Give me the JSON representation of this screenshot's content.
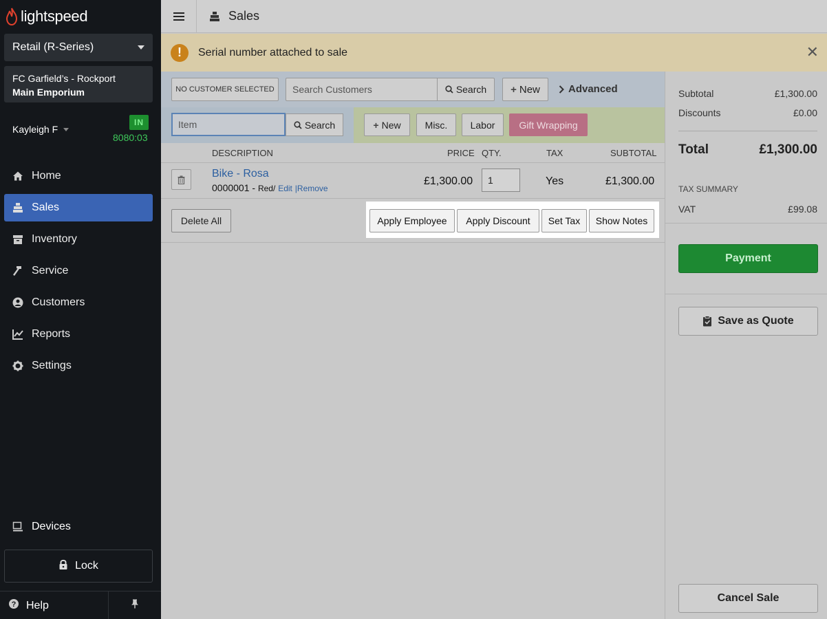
{
  "app": {
    "logo_text": "lightspeed"
  },
  "sidebar": {
    "account_select": "Retail (R-Series)",
    "store_line1": "FC Garfield’s - Rockport",
    "store_line2": "Main Emporium",
    "user_name": "Kayleigh F",
    "status_badge": "IN",
    "clock": "8080:03",
    "nav": [
      {
        "label": "Home",
        "icon": "home-icon"
      },
      {
        "label": "Sales",
        "icon": "register-icon"
      },
      {
        "label": "Inventory",
        "icon": "box-icon"
      },
      {
        "label": "Service",
        "icon": "hammer-icon"
      },
      {
        "label": "Customers",
        "icon": "user-icon"
      },
      {
        "label": "Reports",
        "icon": "chart-icon"
      },
      {
        "label": "Settings",
        "icon": "gear-icon"
      }
    ],
    "devices_label": "Devices",
    "lock_label": "Lock",
    "help_label": "Help"
  },
  "topbar": {
    "title": "Sales"
  },
  "alert": {
    "message": "Serial number attached to sale",
    "icon_text": "!",
    "close": "✕"
  },
  "customer_bar": {
    "no_customer": "NO CUSTOMER SELECTED",
    "search_placeholder": "Search Customers",
    "search_label": "Search",
    "new_label": "New",
    "advanced_label": "Advanced"
  },
  "item_bar": {
    "item_placeholder": "Item",
    "search_label": "Search",
    "new_label": "New",
    "misc_label": "Misc.",
    "labor_label": "Labor",
    "gift_label": "Gift Wrapping"
  },
  "table": {
    "headers": {
      "description": "DESCRIPTION",
      "price": "PRICE",
      "qty": "QTY.",
      "tax": "TAX",
      "subtotal": "SUBTOTAL"
    },
    "rows": [
      {
        "name": "Bike - Rosa",
        "serial": "0000001 -",
        "variant": "Red/",
        "edit": "Edit",
        "separator": "|",
        "remove": "Remove",
        "price": "£1,300.00",
        "qty": "1",
        "tax": "Yes",
        "subtotal": "£1,300.00"
      }
    ]
  },
  "actions": {
    "delete_all": "Delete All",
    "apply_employee": "Apply Employee",
    "apply_discount": "Apply Discount",
    "set_tax": "Set Tax",
    "show_notes": "Show Notes"
  },
  "summary": {
    "subtotal_label": "Subtotal",
    "subtotal_value": "£1,300.00",
    "discounts_label": "Discounts",
    "discounts_value": "£0.00",
    "total_label": "Total",
    "total_value": "£1,300.00",
    "tax_summary_label": "TAX SUMMARY",
    "vat_label": "VAT",
    "vat_value": "£99.08",
    "payment_label": "Payment",
    "quote_label": "Save as Quote",
    "cancel_label": "Cancel Sale"
  },
  "colors": {
    "sidebar_bg": "#14171b",
    "active_nav": "#3a64b4",
    "payment_green": "#1d8932",
    "gift_pink": "#b86f84",
    "logo_red": "#e0412d"
  }
}
